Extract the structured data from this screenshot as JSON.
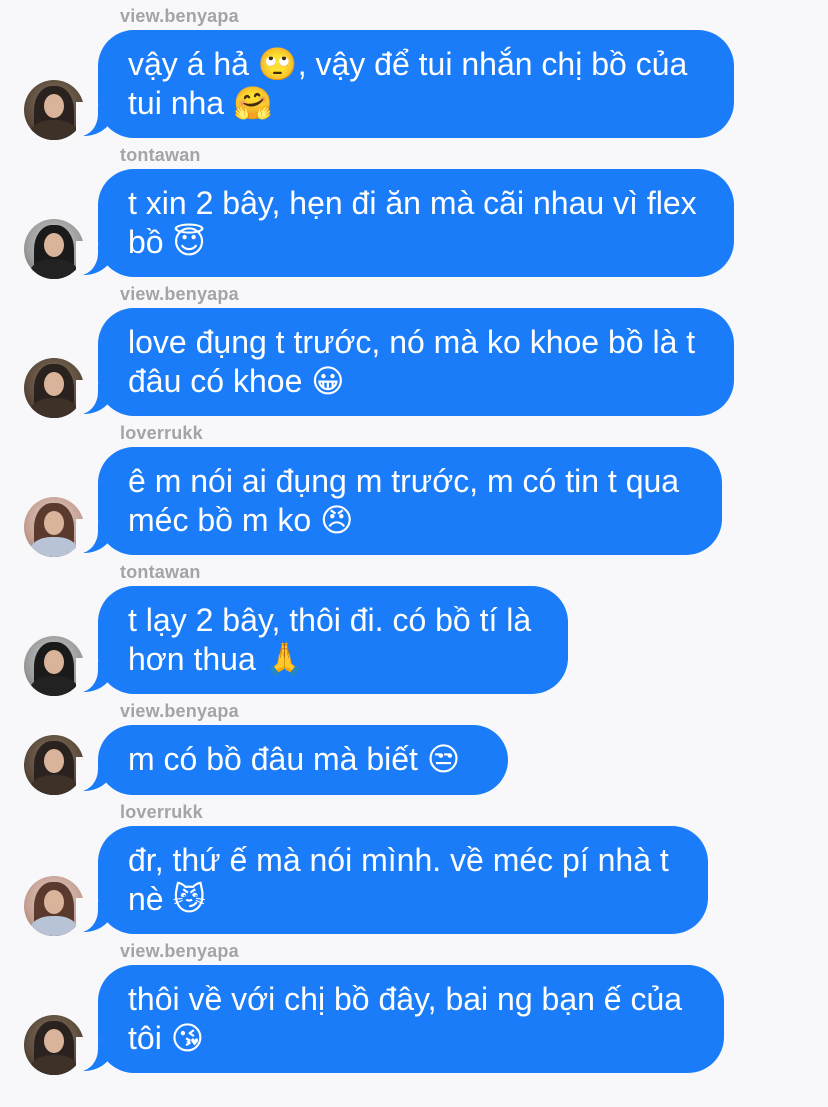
{
  "messages": [
    {
      "sender": "view.benyapa",
      "line1": "vậy á hả 🙄, vậy để tui nhắn chị bồ của",
      "line2": "tui nha 🤗",
      "avatar": "avatar-view-benyapa"
    },
    {
      "sender": "tontawan",
      "line1": "t xin 2 bây, hẹn đi ăn mà cãi nhau vì flex",
      "line2": "bồ 😇",
      "avatar": "avatar-tontawan"
    },
    {
      "sender": "view.benyapa",
      "line1": "love đụng t trước, nó mà ko khoe bồ là t",
      "line2": "đâu có khoe 😀",
      "avatar": "avatar-view-benyapa"
    },
    {
      "sender": "loverrukk",
      "line1": "ê m nói ai đụng m trước, m có tin t qua",
      "line2": "méc bồ m ko 😠",
      "avatar": "avatar-loverrukk"
    },
    {
      "sender": "tontawan",
      "line1": "t lạy 2 bây, thôi đi. có bồ tí là",
      "line2": "hơn thua 🙏",
      "avatar": "avatar-tontawan"
    },
    {
      "sender": "view.benyapa",
      "line1": "m có bồ đâu mà biết 😒",
      "line2": "",
      "avatar": "avatar-view-benyapa"
    },
    {
      "sender": "loverrukk",
      "line1": "đr, thứ ế mà nói mình. về méc pí nhà t",
      "line2": "nè 😼",
      "avatar": "avatar-loverrukk"
    },
    {
      "sender": "view.benyapa",
      "line1": "thôi về với chị bồ đây, bai ng bạn ế của",
      "line2": "tôi 😘",
      "avatar": "avatar-view-benyapa"
    }
  ],
  "colors": {
    "bubble": "#1a7cf9",
    "background": "#f8f8fa",
    "sender_label": "#a3a3a8",
    "bubble_text": "#ffffff"
  }
}
